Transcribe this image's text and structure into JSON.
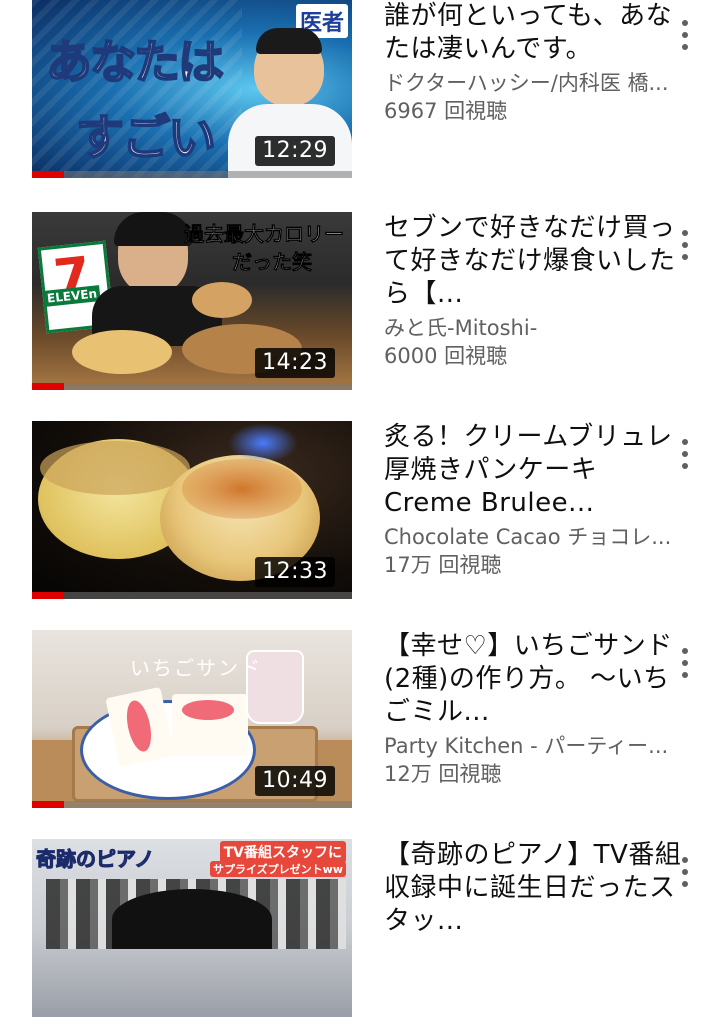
{
  "videos": [
    {
      "title": "誰が何といっても、あなたは凄いんです。",
      "channel": "ドクターハッシー/内科医 橋...",
      "views": "6967 回視聴",
      "duration": "12:29",
      "progress": 0.1,
      "thumb_text": [
        "あなたは",
        "すごい",
        "医者"
      ]
    },
    {
      "title": "セブンで好きなだけ買って好きなだけ爆食いしたら【...",
      "channel": "みと氏-Mitoshi-",
      "views": "6000 回視聴",
      "duration": "14:23",
      "progress": 0.1,
      "thumb_text": [
        "過去最大カロリー",
        "だった笑",
        "ELEVEn"
      ]
    },
    {
      "title": "炙る！クリームブリュレ厚焼きパンケーキ Creme Brulee...",
      "channel": "Chocolate Cacao チョコレ...",
      "views": "17万 回視聴",
      "duration": "12:33",
      "progress": 0.1
    },
    {
      "title": "【幸せ♡】いちごサンド(2種)の作り方。 ～いちごミル...",
      "channel": "Party Kitchen - パーティー...",
      "views": "12万 回視聴",
      "duration": "10:49",
      "progress": 0.1,
      "thumb_text": [
        "いちごサンド"
      ]
    },
    {
      "title": "【奇跡のピアノ】TV番組収録中に誕生日だったスタッ...",
      "channel": "",
      "views": "",
      "duration": "",
      "progress": 0,
      "thumb_text": [
        "奇跡のピアノ",
        "TV番組スタッフに",
        "サプライズプレゼントww"
      ]
    }
  ]
}
